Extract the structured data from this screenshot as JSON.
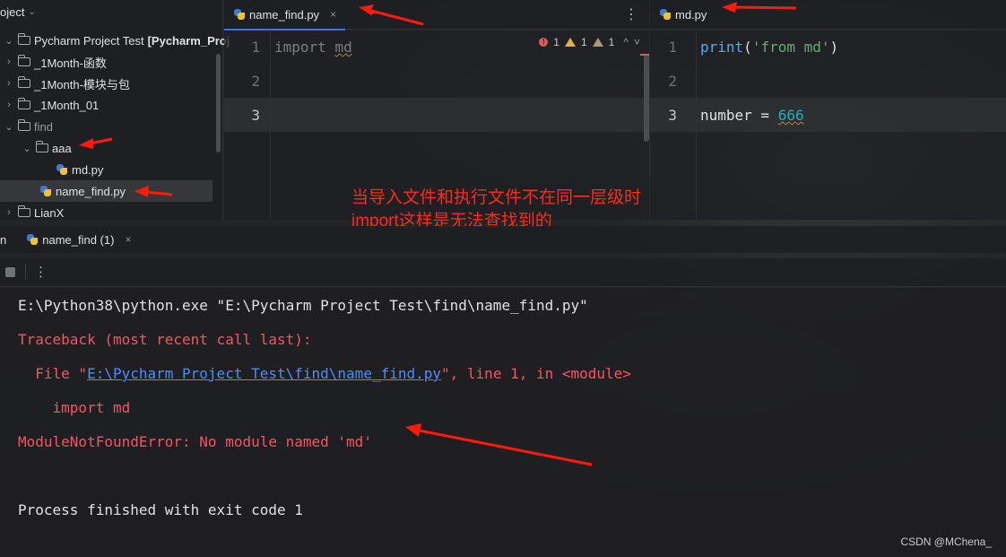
{
  "project": {
    "header": "oject",
    "root_label": "Pycharm Project Test",
    "root_suffix": "[Pycharm_Proj",
    "items": [
      {
        "label": "_1Month-函数"
      },
      {
        "label": "_1Month-模块与包"
      },
      {
        "label": "_1Month_01"
      },
      {
        "label": "find"
      },
      {
        "label": "aaa"
      },
      {
        "label": "md.py"
      },
      {
        "label": "name_find.py"
      },
      {
        "label": "LianX"
      }
    ]
  },
  "editor_left": {
    "tab_label": "name_find.py",
    "close_glyph": "×",
    "more_glyph": "⋮",
    "line_numbers": [
      "1",
      "2",
      "3"
    ],
    "line1_keyword": "import",
    "line1_module": "md",
    "inspections": {
      "errors": "1",
      "warnings": "1",
      "weak_warnings": "1"
    },
    "nav_up": "^",
    "nav_down": "˅"
  },
  "editor_right": {
    "tab_label": "md.py",
    "line_numbers": [
      "1",
      "2",
      "3"
    ],
    "line1_fn": "print",
    "line1_paren_open": "(",
    "line1_string": "'from md'",
    "line1_paren_close": ")",
    "line3_var": "number = ",
    "line3_value": "666"
  },
  "run_panel": {
    "tab_prefix": "n",
    "tab_label": "name_find (1)",
    "close_glyph": "×",
    "toolbar_more": "⋮"
  },
  "console": {
    "line1": "E:\\Python38\\python.exe \"E:\\Pycharm Project Test\\find\\name_find.py\"",
    "line2": "Traceback (most recent call last):",
    "line3_prefix": "  File \"",
    "line3_link": "E:\\Pycharm Project Test\\find\\name_find.py",
    "line3_suffix": "\", line 1, in <module>",
    "line4": "    import md",
    "line5": "ModuleNotFoundError: No module named 'md'",
    "line6": "Process finished with exit code 1"
  },
  "annotation": {
    "line1": "当导入文件和执行文件不在同一层级时",
    "line2": "import这样是无法查找到的"
  },
  "watermark": "CSDN @MChena_",
  "colors": {
    "accent": "#3574f0",
    "error_text": "#f75464",
    "annotation": "#ff2a1a"
  }
}
